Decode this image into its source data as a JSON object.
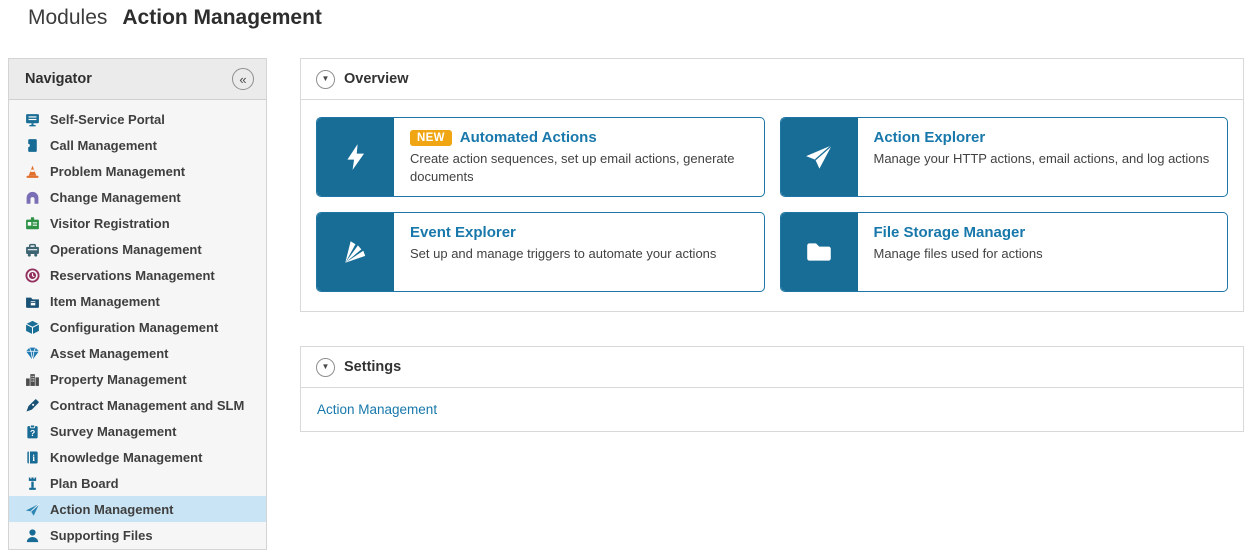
{
  "header": {
    "breadcrumb": "Modules",
    "title": "Action Management"
  },
  "sidebar": {
    "title": "Navigator",
    "collapse_icon": "chevrons-left-icon",
    "items": [
      {
        "label": "Self-Service Portal",
        "icon": "monitor-icon",
        "color": "#1a6e96",
        "selected": false
      },
      {
        "label": "Call Management",
        "icon": "ticket-icon",
        "color": "#176b94",
        "selected": false
      },
      {
        "label": "Problem Management",
        "icon": "traffic-cone-icon",
        "color": "#e2702d",
        "selected": false
      },
      {
        "label": "Change Management",
        "icon": "arch-icon",
        "color": "#7a6fb5",
        "selected": false
      },
      {
        "label": "Visitor Registration",
        "icon": "id-badge-icon",
        "color": "#2f9247",
        "selected": false
      },
      {
        "label": "Operations Management",
        "icon": "service-van-icon",
        "color": "#3c6472",
        "selected": false
      },
      {
        "label": "Reservations Management",
        "icon": "clock-circle-icon",
        "color": "#93305f",
        "selected": false
      },
      {
        "label": "Item Management",
        "icon": "folder-box-icon",
        "color": "#1a5276",
        "selected": false
      },
      {
        "label": "Configuration Management",
        "icon": "cube-icon",
        "color": "#1a6e96",
        "selected": false
      },
      {
        "label": "Asset Management",
        "icon": "gem-icon",
        "color": "#1f79b0",
        "selected": false
      },
      {
        "label": "Property Management",
        "icon": "buildings-icon",
        "color": "#4d4d4d",
        "selected": false
      },
      {
        "label": "Contract Management and SLM",
        "icon": "pen-icon",
        "color": "#1a5276",
        "selected": false
      },
      {
        "label": "Survey Management",
        "icon": "clipboard-question-icon",
        "color": "#176b94",
        "selected": false
      },
      {
        "label": "Knowledge Management",
        "icon": "book-info-icon",
        "color": "#176b94",
        "selected": false
      },
      {
        "label": "Plan Board",
        "icon": "control-tower-icon",
        "color": "#176b94",
        "selected": false
      },
      {
        "label": "Action Management",
        "icon": "paper-plane-icon",
        "color": "#2e86b5",
        "selected": true
      },
      {
        "label": "Supporting Files",
        "icon": "person-icon",
        "color": "#176b94",
        "selected": false
      }
    ]
  },
  "overview": {
    "title": "Overview",
    "cards": [
      {
        "badge": "NEW",
        "title": "Automated Actions",
        "description": "Create action sequences, set up email actions, generate documents",
        "icon": "lightning-icon"
      },
      {
        "badge": null,
        "title": "Action Explorer",
        "description": "Manage your HTTP actions, email actions, and log actions",
        "icon": "paper-plane-icon"
      },
      {
        "badge": null,
        "title": "Event Explorer",
        "description": "Set up and manage triggers to automate your actions",
        "icon": "event-fan-icon"
      },
      {
        "badge": null,
        "title": "File Storage Manager",
        "description": "Manage files used for actions",
        "icon": "folder-icon"
      }
    ]
  },
  "settings": {
    "title": "Settings",
    "links": [
      {
        "label": "Action Management"
      }
    ]
  },
  "colors": {
    "brand_blue": "#176d96",
    "card_border_blue": "#1d76a5",
    "link_blue": "#1878ab",
    "badge_orange": "#f0a513",
    "selected_row_blue": "#c9e4f4"
  }
}
